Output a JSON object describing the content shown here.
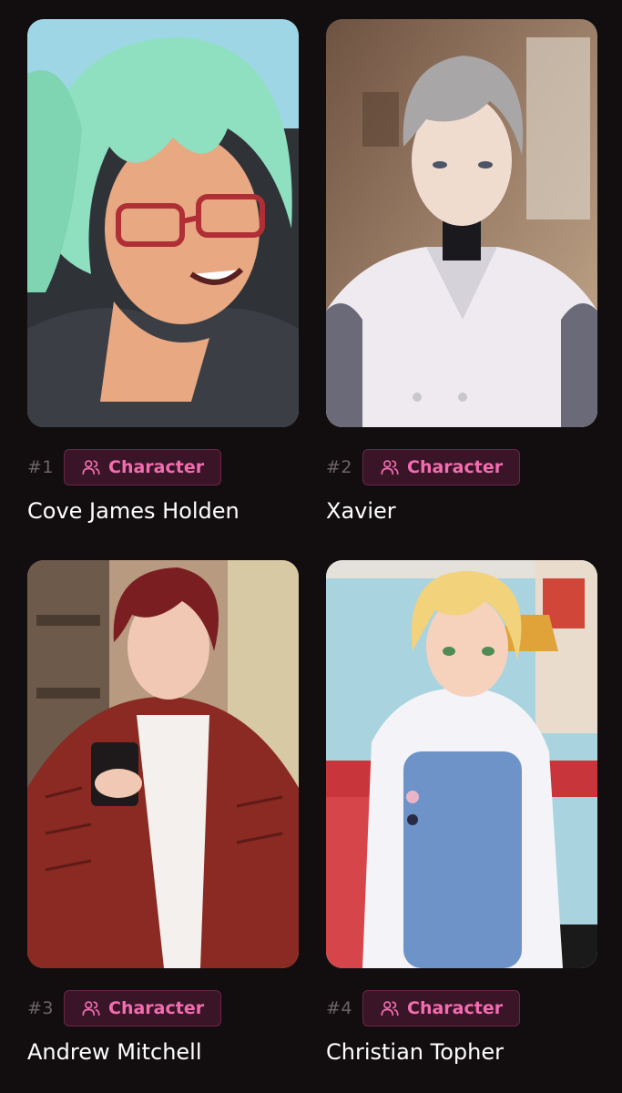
{
  "characters": [
    {
      "rank": "#1",
      "badge": "Character",
      "name": "Cove James Holden",
      "palette": {
        "bg": "#9fd6e6",
        "hair": "#8fe0c0",
        "skin": "#e8a882",
        "cloth": "#3b3f45",
        "accent": "#b02f36"
      }
    },
    {
      "rank": "#2",
      "badge": "Character",
      "name": "Xavier",
      "palette": {
        "bg": "#8a6a52",
        "hair": "#a9a6a8",
        "skin": "#f0dccf",
        "cloth": "#eeeaf0",
        "accent": "#1a1a1e"
      }
    },
    {
      "rank": "#3",
      "badge": "Character",
      "name": "Andrew Mitchell",
      "palette": {
        "bg": "#b89a80",
        "hair": "#7a1e22",
        "skin": "#f0c8b4",
        "cloth": "#8a2a22",
        "accent": "#f4f0ee"
      }
    },
    {
      "rank": "#4",
      "badge": "Character",
      "name": "Christian Topher",
      "palette": {
        "bg": "#a9d4df",
        "hair": "#f2d27a",
        "skin": "#f6d2bd",
        "cloth": "#6d93c9",
        "accent": "#f4f4f8"
      }
    }
  ],
  "theme": {
    "background": "#120e10",
    "badge_text": "#f26db0",
    "badge_bg": "#3a1527",
    "rank_text": "#6d6468"
  },
  "icons": {
    "badge_icon": "people-icon"
  }
}
